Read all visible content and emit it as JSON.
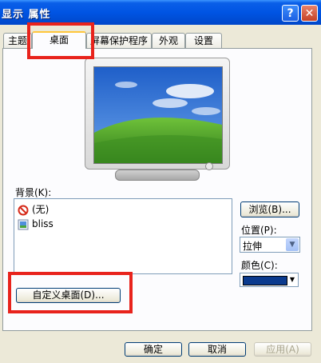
{
  "window": {
    "title": "显示 属性",
    "help_btn": "?",
    "close_btn": "✕"
  },
  "tabs": [
    {
      "label": "主题",
      "active": false
    },
    {
      "label": "桌面",
      "active": true
    },
    {
      "label": "屏幕保护程序",
      "active": false
    },
    {
      "label": "外观",
      "active": false
    },
    {
      "label": "设置",
      "active": false
    }
  ],
  "background": {
    "label": "背景(K):",
    "items": [
      {
        "label": "(无)",
        "icon": "no-icon"
      },
      {
        "label": "bliss",
        "icon": "image-file-icon"
      }
    ]
  },
  "browse_btn": "浏览(B)...",
  "position": {
    "label": "位置(P):",
    "value": "拉伸"
  },
  "color": {
    "label": "颜色(C):",
    "value": "#0b3a8e"
  },
  "customize_btn": "自定义桌面(D)...",
  "footer": {
    "ok": "确定",
    "cancel": "取消",
    "apply": "应用(A)"
  },
  "colors": {
    "titlebar": "#0054e3",
    "active_tab_accent": "#ffc73c",
    "highlight": "#e8231c"
  }
}
